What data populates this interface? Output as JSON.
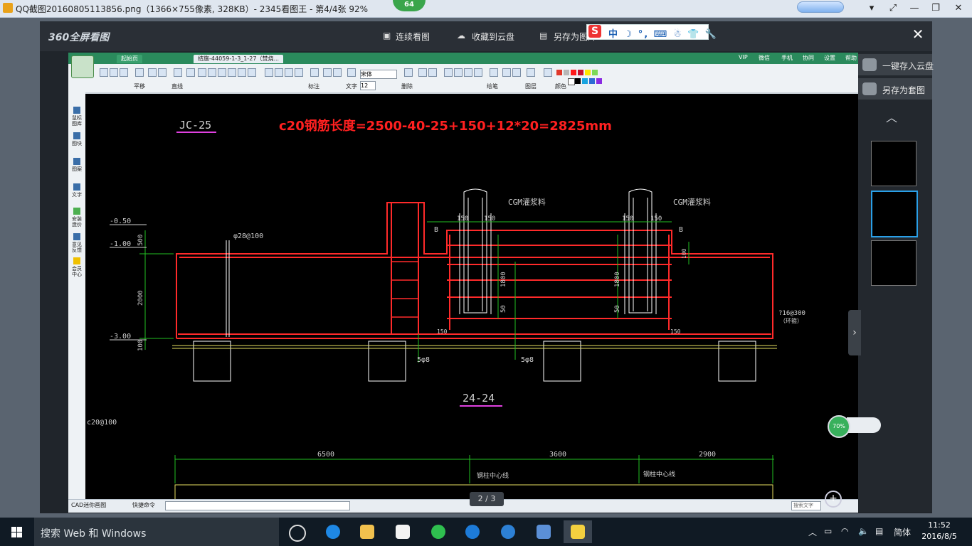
{
  "window": {
    "title": "QQ截图20160805113856.png（1366×755像素, 328KB）- 2345看图王 - 第4/4张 92%",
    "badge": "64",
    "buttons": [
      "−",
      "⤢",
      "—",
      "❐",
      "✕"
    ]
  },
  "viewer": {
    "logo": "360全屏看图",
    "actions": [
      {
        "icon": "play-icon",
        "label": "连续看图"
      },
      {
        "icon": "cloud-icon",
        "label": "收藏到云盘"
      },
      {
        "icon": "save-icon",
        "label": "另存为图片"
      }
    ],
    "close": "✕",
    "ime": {
      "logo": "S",
      "text": "中 ☽ °, ⌨ ☃ 👕 🔧"
    }
  },
  "right_panel": {
    "save_cloud": "一键存入云盘",
    "save_template": "另存为套图",
    "up": "︿",
    "side_chevron": "›",
    "zoom_percent": "70%"
  },
  "pager": "2 / 3",
  "cad": {
    "tabs": [
      "起始页",
      "结施-44059-1-3_1-27（焚烧..."
    ],
    "top_menu": [
      "VIP",
      "微信",
      "手机",
      "协同",
      "设置",
      "帮助"
    ],
    "ribbon_labels": [
      "平移",
      "直线",
      "标注",
      "文字",
      "删除",
      "绘笔",
      "图层",
      "颜色"
    ],
    "font_name": "宋体",
    "font_size": "12",
    "left_items": [
      {
        "label": "鼠标图库"
      },
      {
        "label": "图块"
      },
      {
        "label": "图案"
      },
      {
        "label": "文字"
      },
      {
        "label": "安装造价"
      },
      {
        "label": "意见反馈"
      },
      {
        "label": "会员中心"
      }
    ],
    "bottom": {
      "app": "CAD迷你画图",
      "cmd": "快捷命令",
      "search": "搜索文字"
    }
  },
  "drawing": {
    "jc_label": "JC-25",
    "formula": "c20钢筋长度=2500-40-25+150+12*20=2825mm",
    "section_label": "24-24",
    "cgm1": "CGM灌浆料",
    "cgm2": "CGM灌浆料",
    "elev1": "-0.50",
    "elev2": "-1.00",
    "elev3": "-3.00",
    "dim500": "500",
    "dim2000": "2000",
    "dim100": "100",
    "bar1": "φ28@100",
    "b1": "B",
    "b2": "B",
    "d150a": "150",
    "d150b": "150",
    "d150c": "150",
    "d150d": "150",
    "d150e": "150",
    "d150f": "150",
    "d1800a": "1800",
    "d1800b": "1800",
    "d50a": "50",
    "d50b": "50",
    "d100r": "100",
    "tie": "?16@300",
    "tie2": "（环箍）",
    "s1": "5φ8",
    "s2": "5φ8",
    "c20": "c20@100",
    "dim6500": "6500",
    "dim3600": "3600",
    "dim2900": "2900",
    "axis1": "钢柱中心线",
    "axis2": "钢柱中心线"
  },
  "taskbar": {
    "search": "搜索 Web 和 Windows",
    "lang": "简体",
    "time": "11:52",
    "date": "2016/8/5"
  },
  "colors": {
    "accent_green": "#2a8a5c",
    "formula_red": "#ff2020",
    "rebar_red": "#ff2a2a"
  }
}
